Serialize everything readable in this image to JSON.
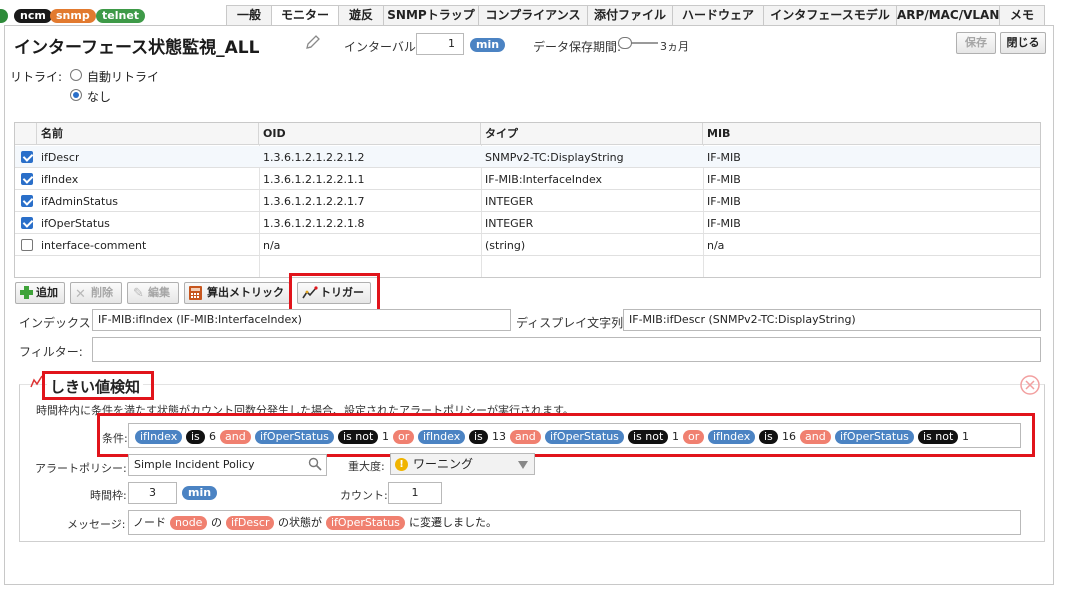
{
  "header_badges": [
    {
      "label": "ncm",
      "color": "#1a1a1a"
    },
    {
      "label": "snmp",
      "color": "#e27a2f"
    },
    {
      "label": "telnet",
      "color": "#3e9a48"
    }
  ],
  "tabs": [
    {
      "label": "一般",
      "active": false
    },
    {
      "label": "モニター",
      "active": true
    },
    {
      "label": "遊反",
      "active": false
    },
    {
      "label": "SNMPトラップ",
      "active": false
    },
    {
      "label": "コンプライアンス",
      "active": false
    },
    {
      "label": "添付ファイル",
      "active": false
    },
    {
      "label": "ハードウェア",
      "active": false
    },
    {
      "label": "インタフェースモデル",
      "active": false
    },
    {
      "label": "ARP/MAC/VLAN",
      "active": false
    },
    {
      "label": "メモ",
      "active": false
    }
  ],
  "monitor": {
    "title": "インターフェース状態監視_ALL",
    "interval_label": "インターバル:",
    "interval_value": "1",
    "interval_unit": "min",
    "retention_label": "データ保存期間:",
    "retention_value": "3ヵ月",
    "save_label": "保存",
    "close_label": "閉じる"
  },
  "retry": {
    "label": "リトライ:",
    "options": [
      {
        "label": "自動リトライ",
        "selected": false
      },
      {
        "label": "なし",
        "selected": true
      }
    ]
  },
  "table": {
    "headers": [
      "名前",
      "OID",
      "タイプ",
      "MIB"
    ],
    "rows": [
      {
        "checked": true,
        "name": "ifDescr",
        "oid": "1.3.6.1.2.1.2.2.1.2",
        "type": "SNMPv2-TC:DisplayString",
        "mib": "IF-MIB"
      },
      {
        "checked": true,
        "name": "ifIndex",
        "oid": "1.3.6.1.2.1.2.2.1.1",
        "type": "IF-MIB:InterfaceIndex",
        "mib": "IF-MIB"
      },
      {
        "checked": true,
        "name": "ifAdminStatus",
        "oid": "1.3.6.1.2.1.2.2.1.7",
        "type": "INTEGER",
        "mib": "IF-MIB"
      },
      {
        "checked": true,
        "name": "ifOperStatus",
        "oid": "1.3.6.1.2.1.2.2.1.8",
        "type": "INTEGER",
        "mib": "IF-MIB"
      },
      {
        "checked": false,
        "name": "interface-comment",
        "oid": "n/a",
        "type": "(string)",
        "mib": "n/a"
      }
    ]
  },
  "toolbar": {
    "add": "追加",
    "delete": "削除",
    "edit": "編集",
    "calc_metric": "算出メトリック",
    "trigger": "トリガー"
  },
  "index": {
    "label": "インデックス:",
    "value": "IF-MIB:ifIndex (IF-MIB:InterfaceIndex)",
    "display_label": "ディスプレイ文字列:",
    "display_value": "IF-MIB:ifDescr (SNMPv2-TC:DisplayString)",
    "filter_label": "フィルター:",
    "filter_value": ""
  },
  "threshold": {
    "title": "しきい値検知",
    "description": "時間枠内に条件を満たす状態がカウント回数分発生した場合、設定されたアラートポリシーが実行されます。",
    "condition_label": "条件:",
    "condition_tokens": [
      {
        "kind": "field",
        "text": "ifIndex"
      },
      {
        "kind": "op",
        "text": "is"
      },
      {
        "kind": "val",
        "text": "6"
      },
      {
        "kind": "conj",
        "text": "and"
      },
      {
        "kind": "field",
        "text": "ifOperStatus"
      },
      {
        "kind": "op",
        "text": "is not"
      },
      {
        "kind": "val",
        "text": "1"
      },
      {
        "kind": "conj",
        "text": "or"
      },
      {
        "kind": "field",
        "text": "ifIndex"
      },
      {
        "kind": "op",
        "text": "is"
      },
      {
        "kind": "val",
        "text": "13"
      },
      {
        "kind": "conj",
        "text": "and"
      },
      {
        "kind": "field",
        "text": "ifOperStatus"
      },
      {
        "kind": "op",
        "text": "is not"
      },
      {
        "kind": "val",
        "text": "1"
      },
      {
        "kind": "conj",
        "text": "or"
      },
      {
        "kind": "field",
        "text": "ifIndex"
      },
      {
        "kind": "op",
        "text": "is"
      },
      {
        "kind": "val",
        "text": "16"
      },
      {
        "kind": "conj",
        "text": "and"
      },
      {
        "kind": "field",
        "text": "ifOperStatus"
      },
      {
        "kind": "op",
        "text": "is not"
      },
      {
        "kind": "val",
        "text": "1"
      }
    ],
    "alert_policy_label": "アラートポリシー:",
    "alert_policy_value": "Simple Incident Policy",
    "severity_label": "重大度:",
    "severity_value": "ワーニング",
    "window_label": "時間枠:",
    "window_value": "3",
    "window_unit": "min",
    "count_label": "カウント:",
    "count_value": "1",
    "message_label": "メッセージ:",
    "message_parts": [
      {
        "kind": "text",
        "text": "ノード"
      },
      {
        "kind": "var",
        "text": "node"
      },
      {
        "kind": "text",
        "text": "の"
      },
      {
        "kind": "var",
        "text": "ifDescr"
      },
      {
        "kind": "text",
        "text": "の状態が"
      },
      {
        "kind": "var",
        "text": "ifOperStatus"
      },
      {
        "kind": "text",
        "text": "に変遷しました。"
      }
    ]
  },
  "colors": {
    "field_token": "#4b83c3",
    "conj_token": "#f08070",
    "op_token": "#111111",
    "highlight_box": "#e1141b"
  }
}
